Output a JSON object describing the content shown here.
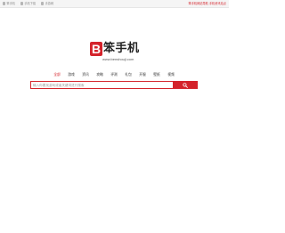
{
  "topbar": {
    "links": [
      {
        "label": "笨手机",
        "icon": "phone-icon"
      },
      {
        "label": "手机下载",
        "icon": "download-icon"
      },
      {
        "label": "手游网",
        "icon": "gamepad-icon"
      }
    ],
    "right_text": "笨手机网站导航 手机资讯站点"
  },
  "logo": {
    "mark": "B",
    "name": "笨手机",
    "url": "www.benshouji.com"
  },
  "tabs": [
    {
      "label": "全部",
      "active": true
    },
    {
      "label": "游戏",
      "active": false
    },
    {
      "label": "资讯",
      "active": false
    },
    {
      "label": "攻略",
      "active": false
    },
    {
      "label": "评测",
      "active": false
    },
    {
      "label": "礼包",
      "active": false
    },
    {
      "label": "开服",
      "active": false
    },
    {
      "label": "壁纸",
      "active": false
    },
    {
      "label": "视频",
      "active": false
    }
  ],
  "search": {
    "placeholder": "输入你要找游戏或者关键词进行搜索",
    "button_icon": "search-icon"
  },
  "colors": {
    "accent": "#d4232b",
    "topbar": "#f5f5f5"
  }
}
